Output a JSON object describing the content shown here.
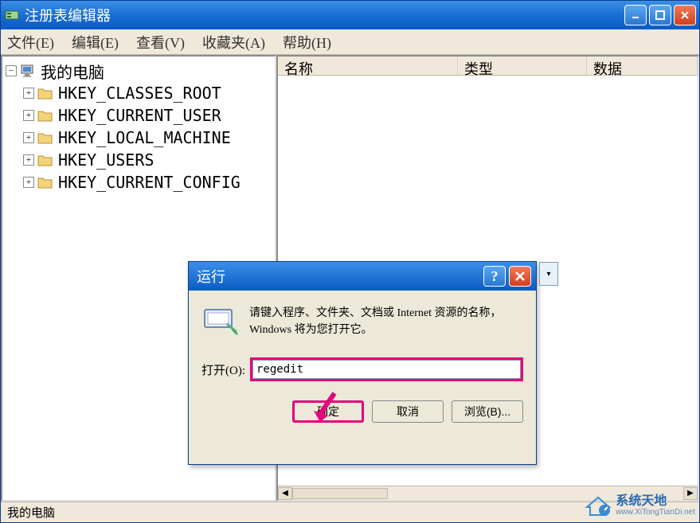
{
  "window": {
    "title": "注册表编辑器",
    "controls": {
      "min": "−",
      "max": "□",
      "close": "×"
    }
  },
  "menubar": {
    "file": "文件(E)",
    "edit": "编辑(E)",
    "view": "查看(V)",
    "favorites": "收藏夹(A)",
    "help": "帮助(H)"
  },
  "tree": {
    "root": {
      "label": "我的电脑",
      "expanded": true
    },
    "items": [
      {
        "label": "HKEY_CLASSES_ROOT"
      },
      {
        "label": "HKEY_CURRENT_USER"
      },
      {
        "label": "HKEY_LOCAL_MACHINE"
      },
      {
        "label": "HKEY_USERS"
      },
      {
        "label": "HKEY_CURRENT_CONFIG"
      }
    ]
  },
  "list": {
    "columns": {
      "name": "名称",
      "type": "类型",
      "data": "数据"
    }
  },
  "statusbar": {
    "text": "我的电脑"
  },
  "dialog": {
    "title": "运行",
    "help": "?",
    "close": "×",
    "message": "请键入程序、文件夹、文档或 Internet 资源的名称，Windows 将为您打开它。",
    "open_label": "打开(O):",
    "open_value": "regedit",
    "buttons": {
      "ok": "确定",
      "cancel": "取消",
      "browse": "浏览(B)..."
    }
  },
  "watermark": {
    "main": "系统天地",
    "sub": "www.XiTongTianDi.net"
  }
}
